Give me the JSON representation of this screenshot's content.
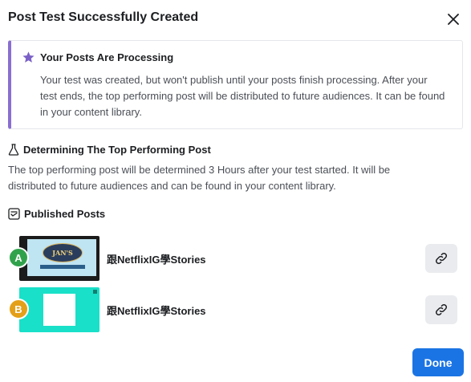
{
  "dialog": {
    "title": "Post Test Successfully Created",
    "close_icon": "close-icon"
  },
  "notice": {
    "icon": "star-icon",
    "icon_color": "#7b61c6",
    "accent_color": "#8a6fd1",
    "title": "Your Posts Are Processing",
    "body": "Your test was created, but won't publish until your posts finish processing. After your test ends, the top performing post will be distributed to future audiences. It can be found in your content library."
  },
  "top_post": {
    "icon": "flask-icon",
    "heading": "Determining The Top Performing Post",
    "body": "The top performing post will be determined 3 Hours after your test started. It will be distributed to future audiences and can be found in your content library."
  },
  "published": {
    "icon": "posts-icon",
    "heading": "Published Posts",
    "posts": [
      {
        "badge": "A",
        "badge_color": "#31a24c",
        "name": "跟NetflixIG學Stories",
        "thumb_text": "JAN'S",
        "link_icon": "link-icon"
      },
      {
        "badge": "B",
        "badge_color": "#e3a018",
        "name": "跟NetflixIG學Stories",
        "thumb_text": "",
        "link_icon": "link-icon"
      }
    ]
  },
  "footer": {
    "done_label": "Done",
    "accent": "#1b74e4"
  }
}
